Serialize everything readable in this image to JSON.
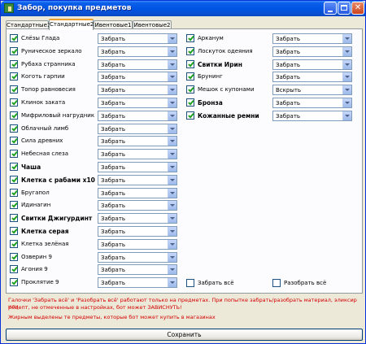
{
  "window": {
    "title": "Забор, покупка предметов",
    "colors": {
      "titlebar": "#0054e3",
      "face": "#ece9d8",
      "note": "#d40000",
      "check": "#21a121"
    }
  },
  "tabs": [
    {
      "label": "Стандартные1",
      "active": false
    },
    {
      "label": "Стандартные2",
      "active": true
    },
    {
      "label": "Ивентовые1",
      "active": false
    },
    {
      "label": "Ивентовые2",
      "active": false
    }
  ],
  "left_items": [
    {
      "label": "Слёзы Глада",
      "checked": true,
      "bold": false,
      "action": "Забрать"
    },
    {
      "label": "Руническое зеркало",
      "checked": true,
      "bold": false,
      "action": "Забрать"
    },
    {
      "label": "Рубаха странника",
      "checked": true,
      "bold": false,
      "action": "Забрать"
    },
    {
      "label": "Коготь гарпии",
      "checked": true,
      "bold": false,
      "action": "Забрать"
    },
    {
      "label": "Топор равновесия",
      "checked": true,
      "bold": false,
      "action": "Забрать"
    },
    {
      "label": "Клинок заката",
      "checked": true,
      "bold": false,
      "action": "Забрать"
    },
    {
      "label": "Мифриловый нагрудник",
      "checked": true,
      "bold": false,
      "action": "Забрать"
    },
    {
      "label": "Облачный лимб",
      "checked": true,
      "bold": false,
      "action": "Забрать"
    },
    {
      "label": "Сила древних",
      "checked": true,
      "bold": false,
      "action": "Забрать"
    },
    {
      "label": "Небесная слеза",
      "checked": true,
      "bold": false,
      "action": "Забрать"
    },
    {
      "label": "Чаша",
      "checked": true,
      "bold": true,
      "action": "Забрать"
    },
    {
      "label": "Клетка с рабами x10",
      "checked": true,
      "bold": true,
      "action": "Забрать"
    },
    {
      "label": "Бругапол",
      "checked": true,
      "bold": false,
      "action": "Забрать"
    },
    {
      "label": "Идинагин",
      "checked": true,
      "bold": false,
      "action": "Забрать"
    },
    {
      "label": "Свитки Джигурдинт",
      "checked": true,
      "bold": true,
      "action": "Забрать"
    },
    {
      "label": "Клетка серая",
      "checked": true,
      "bold": true,
      "action": "Забрать"
    },
    {
      "label": "Клетка зелёная",
      "checked": true,
      "bold": false,
      "action": "Забрать"
    },
    {
      "label": "Озверин 9",
      "checked": true,
      "bold": false,
      "action": "Забрать"
    },
    {
      "label": "Агония 9",
      "checked": true,
      "bold": false,
      "action": "Забрать"
    },
    {
      "label": "Проклятие 9",
      "checked": true,
      "bold": false,
      "action": "Забрать"
    }
  ],
  "right_items": [
    {
      "label": "Арканум",
      "checked": true,
      "bold": false,
      "action": "Забрать"
    },
    {
      "label": "Лоскуток одеяния",
      "checked": true,
      "bold": false,
      "action": "Забрать"
    },
    {
      "label": "Свитки Ирин",
      "checked": true,
      "bold": true,
      "action": "Забрать"
    },
    {
      "label": "Брунинг",
      "checked": true,
      "bold": false,
      "action": "Забрать"
    },
    {
      "label": "Мешок с купонами",
      "checked": true,
      "bold": false,
      "action": "Вскрыть"
    },
    {
      "label": "Бронза",
      "checked": true,
      "bold": true,
      "action": "Забрать"
    },
    {
      "label": "Кожанные ремни",
      "checked": true,
      "bold": true,
      "action": "Забрать"
    }
  ],
  "take_all": {
    "label": "Забрать всё",
    "checked": false
  },
  "disassemble_all": {
    "label": "Разобрать всё",
    "checked": false
  },
  "notes": {
    "line1": "Галочки 'Забрать всё' и 'Разобрать всё' работают только на предметах. При попытке забрать/разобрать материал, эликсир или",
    "line2": "рецепт, не отмеченные в настройках, бот может ЗАВИСНУТЬ!",
    "line3": "Жирным выделены те предметы, которые бот может купить в магазинах"
  },
  "save_label": "Сохранить"
}
